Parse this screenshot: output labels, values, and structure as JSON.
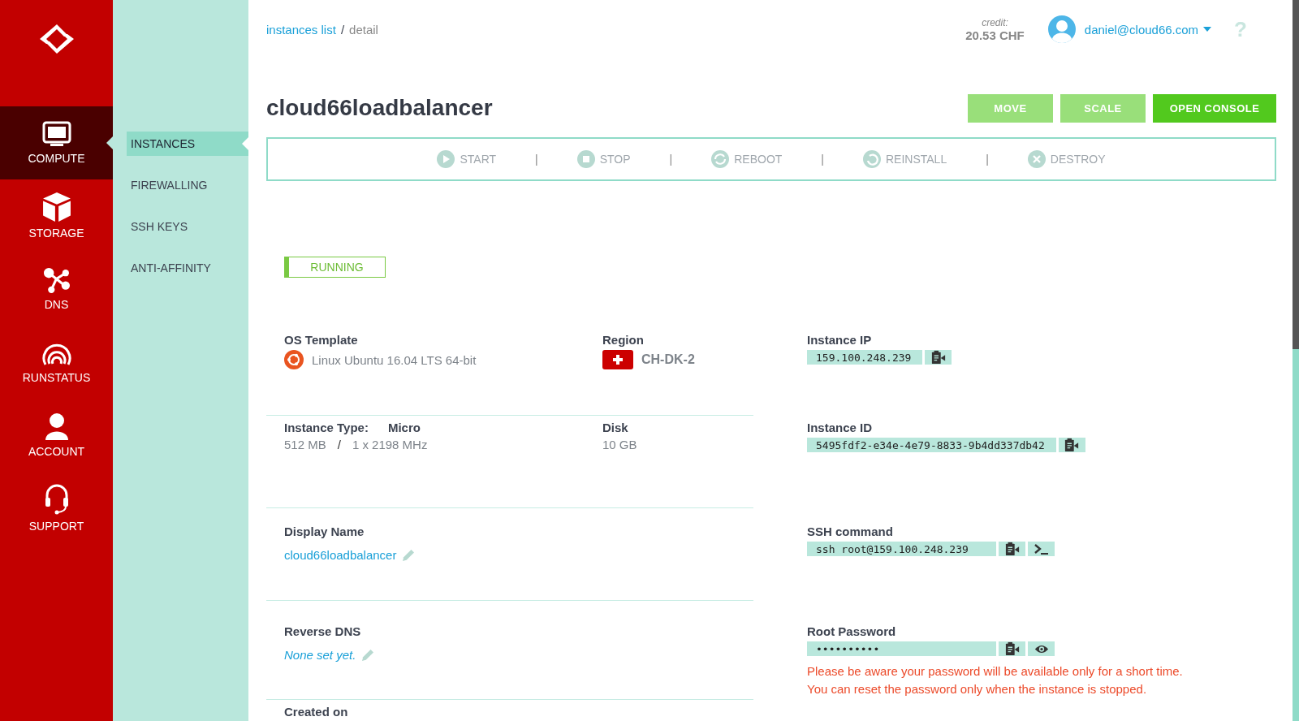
{
  "sidebar": {
    "items": [
      {
        "label": "COMPUTE",
        "selected": true
      },
      {
        "label": "STORAGE",
        "selected": false
      },
      {
        "label": "DNS",
        "selected": false
      },
      {
        "label": "RUNSTATUS",
        "selected": false
      },
      {
        "label": "ACCOUNT",
        "selected": false
      },
      {
        "label": "SUPPORT",
        "selected": false
      }
    ]
  },
  "subnav": {
    "items": [
      {
        "label": "INSTANCES",
        "selected": true
      },
      {
        "label": "FIREWALLING",
        "selected": false
      },
      {
        "label": "SSH KEYS",
        "selected": false
      },
      {
        "label": "ANTI-AFFINITY",
        "selected": false
      }
    ]
  },
  "breadcrumb": {
    "link": "instances list",
    "separator": "/",
    "current": "detail"
  },
  "account": {
    "credit_label": "credit:",
    "credit": "20.53 CHF",
    "email": "daniel@cloud66.com",
    "help": "?"
  },
  "title": "cloud66loadbalancer",
  "buttons": [
    {
      "label": "MOVE",
      "primary": false
    },
    {
      "label": "SCALE",
      "primary": false
    },
    {
      "label": "OPEN CONSOLE",
      "primary": true
    }
  ],
  "actions": {
    "separator": "|",
    "items": [
      {
        "label": "START"
      },
      {
        "label": "STOP"
      },
      {
        "label": "REBOOT"
      },
      {
        "label": "REINSTALL"
      },
      {
        "label": "DESTROY"
      }
    ]
  },
  "status": "RUNNING",
  "os_template": {
    "label": "OS Template",
    "value": "Linux Ubuntu 16.04 LTS 64-bit"
  },
  "region": {
    "label": "Region",
    "value": "CH-DK-2"
  },
  "instance_type": {
    "label": "Instance Type:",
    "value": "Micro",
    "memory": "512 MB",
    "separator": "/",
    "cpu": "1 x 2198 MHz"
  },
  "disk": {
    "label": "Disk",
    "value": "10 GB"
  },
  "display_name": {
    "label": "Display Name",
    "value": "cloud66loadbalancer"
  },
  "reverse_dns": {
    "label": "Reverse DNS",
    "value": "None set yet."
  },
  "created_on": {
    "label": "Created on"
  },
  "fields": [
    {
      "label": "Instance IP",
      "value": "159.100.248.239",
      "kind": "plain"
    },
    {
      "label": "Instance ID",
      "value": "5495fdf2-e34e-4e79-8833-9b4dd337db42",
      "kind": "plain"
    },
    {
      "label": "SSH command",
      "value": "ssh root@159.100.248.239",
      "kind": "command"
    },
    {
      "label": "Root Password",
      "value": "••••••••••",
      "kind": "secret"
    }
  ],
  "password_warning": [
    "Please be aware your password will be available only for a short time.",
    "You can reset the password only when the instance is stopped."
  ]
}
